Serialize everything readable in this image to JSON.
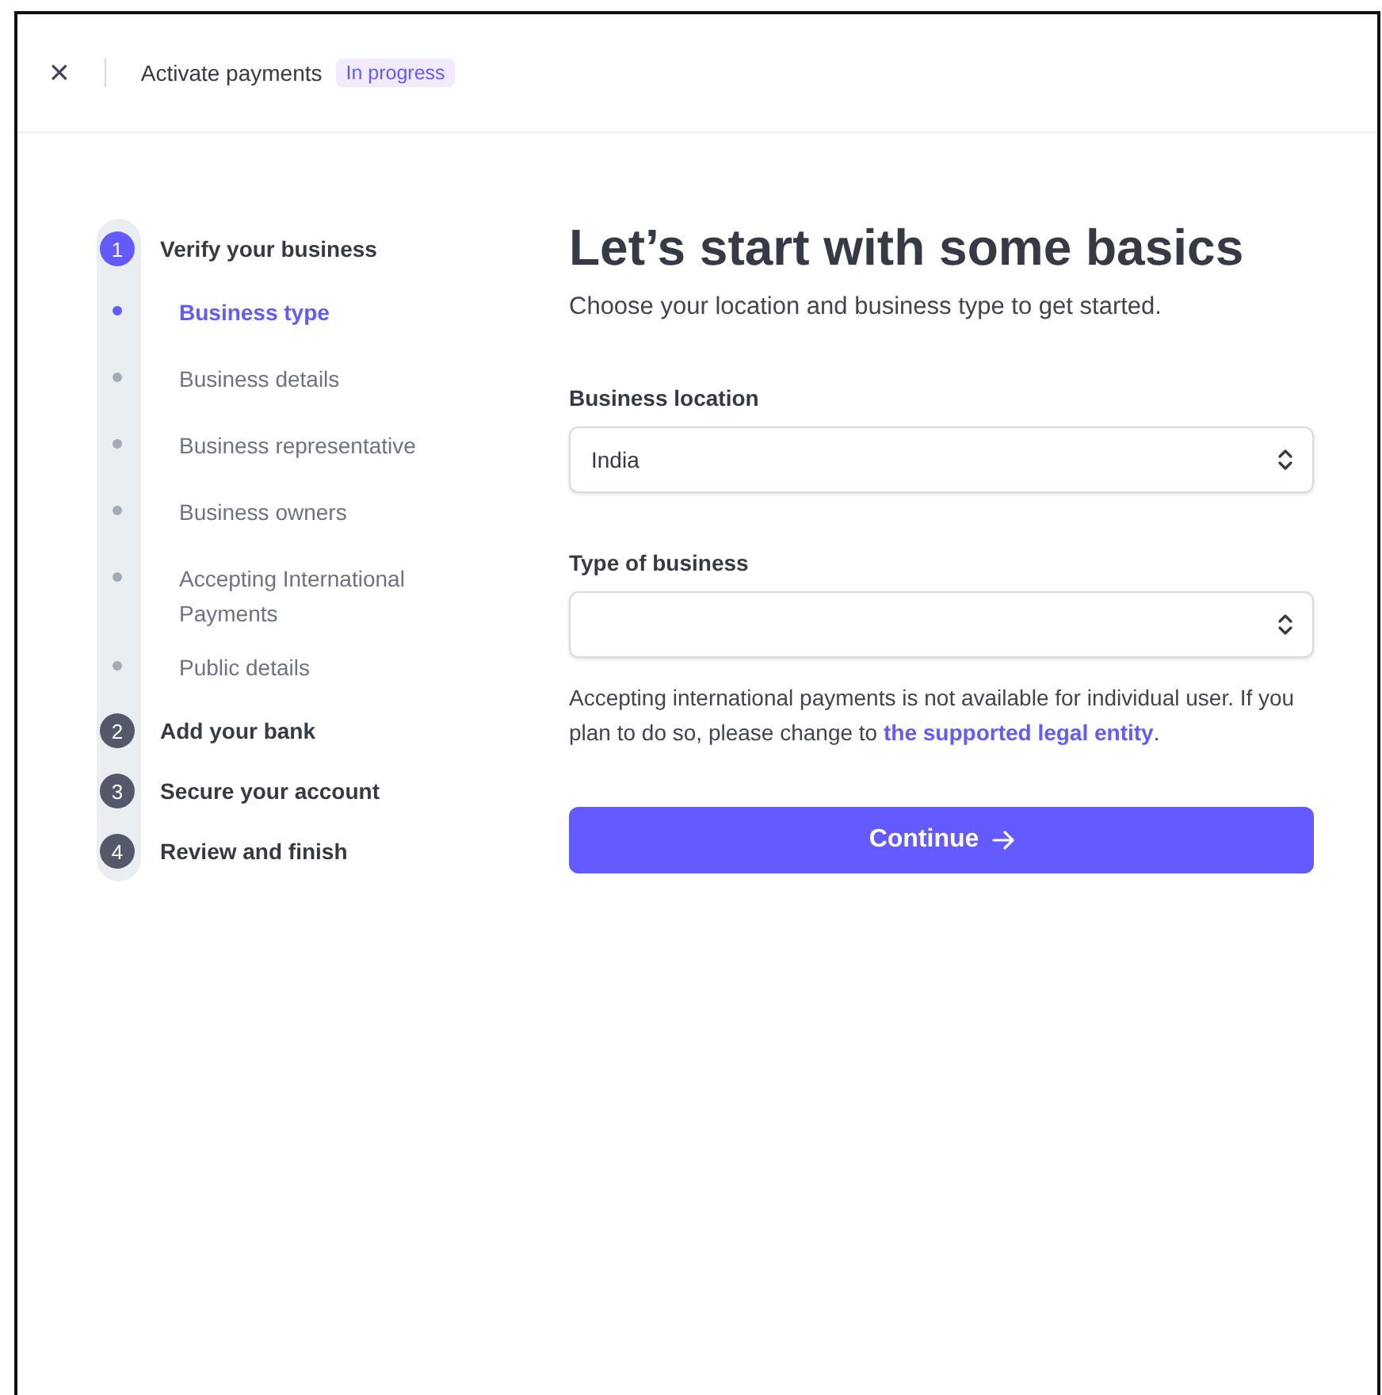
{
  "header": {
    "close": "×",
    "title": "Activate payments",
    "badge": "In progress"
  },
  "steps": [
    {
      "number": "1",
      "label": "Verify your business",
      "selected": true,
      "children": [
        {
          "label": "Business type",
          "selected": true
        },
        {
          "label": "Business details",
          "selected": false
        },
        {
          "label": "Business representative",
          "selected": false
        },
        {
          "label": "Business owners",
          "selected": false
        },
        {
          "label": "Accepting International Payments",
          "selected": false
        },
        {
          "label": "Public details",
          "selected": false
        }
      ]
    },
    {
      "number": "2",
      "label": "Add your bank",
      "selected": false
    },
    {
      "number": "3",
      "label": "Secure your account",
      "selected": false
    },
    {
      "number": "4",
      "label": "Review and finish",
      "selected": false
    }
  ],
  "heading": "Let’s start with some basics",
  "subheading": "Choose your location and business type to get started.",
  "fields": [
    {
      "label": "Business location",
      "value": "India"
    },
    {
      "label": "Type of business"
    }
  ],
  "note": {
    "text": "Accepting international payments is not available for individual user. If you plan to do so, please change to",
    "link": "the supported legal entity",
    "after": "."
  },
  "button": {
    "label": "Continue"
  }
}
